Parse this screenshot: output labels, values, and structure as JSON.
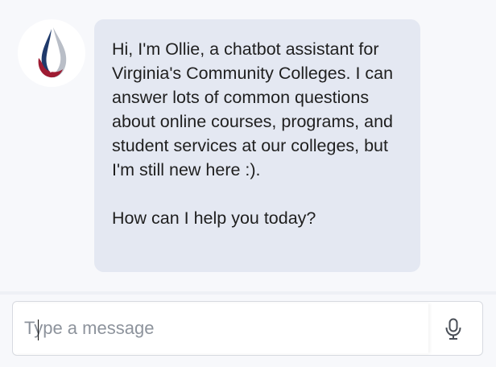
{
  "bot": {
    "avatar_icon": "ollie-logo-icon",
    "message_paragraphs": [
      "Hi, I'm Ollie, a chatbot assistant for Virginia's Community Colleges. I can answer lots of common questions about online courses, programs, and student services at our colleges, but I'm still new here :).",
      "How can I help you today?"
    ]
  },
  "composer": {
    "placeholder": "Type a message",
    "value": "",
    "mic_icon": "microphone-icon"
  },
  "colors": {
    "bubble_bg": "#e4e8f2",
    "logo_blue": "#1f3a6b",
    "logo_red": "#9e1b32",
    "logo_gray": "#b9bec7"
  }
}
